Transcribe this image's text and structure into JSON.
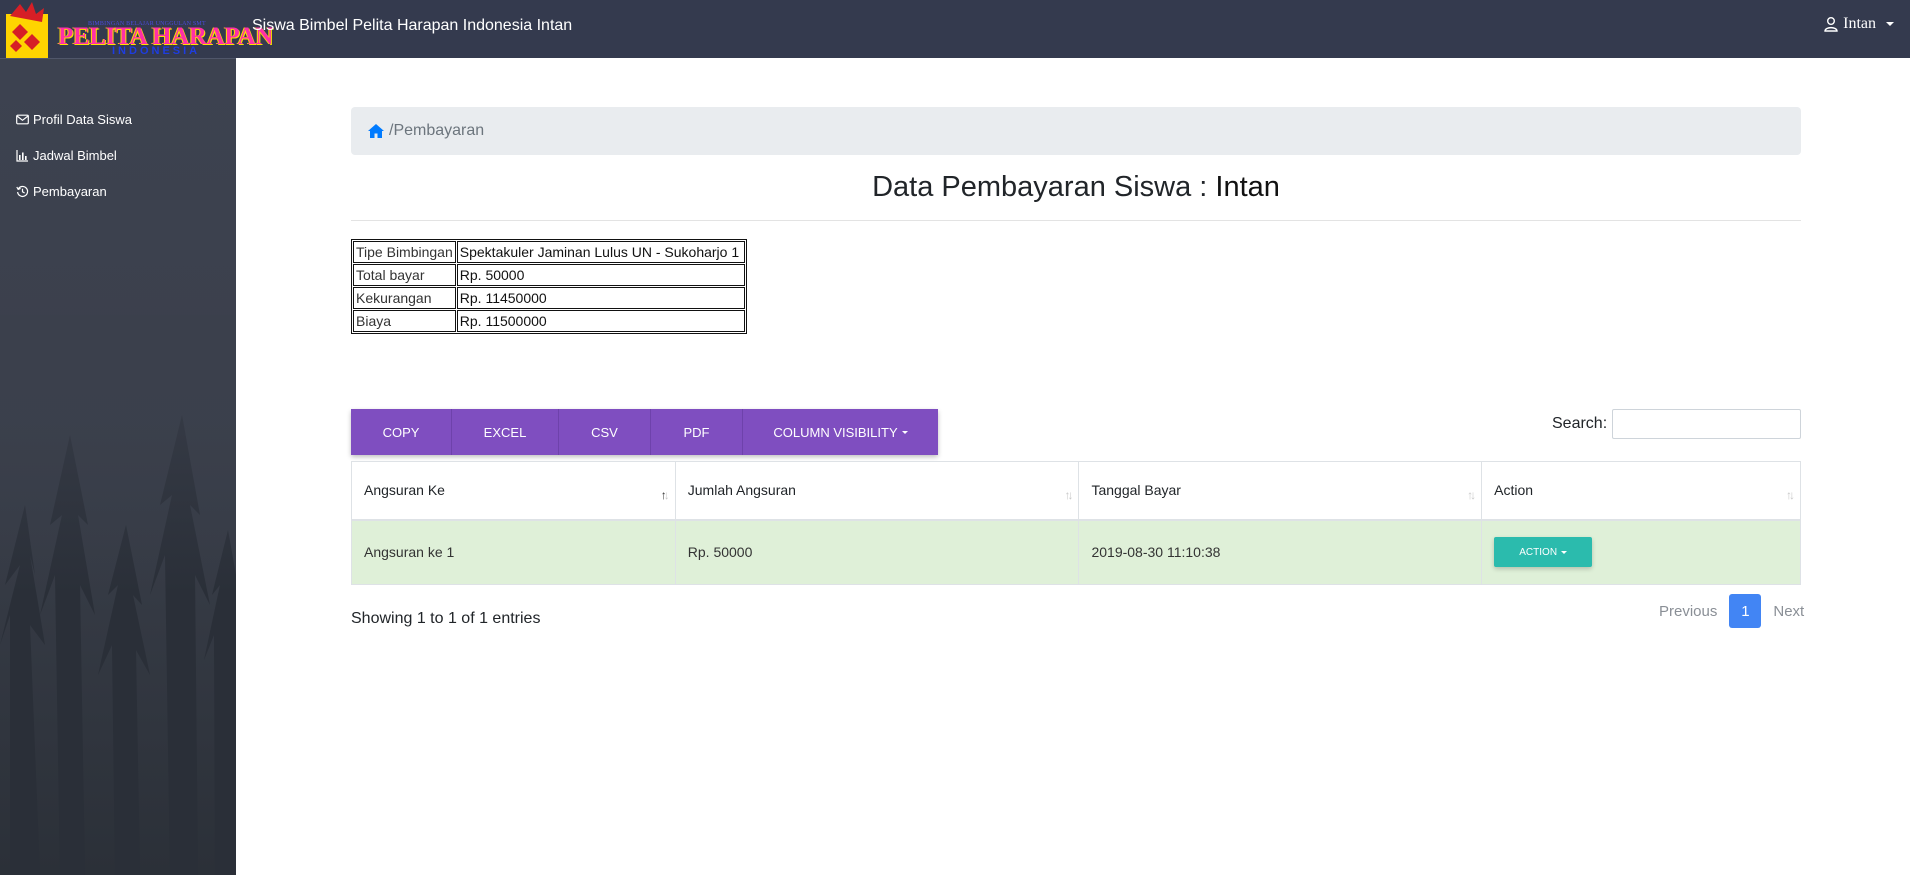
{
  "header": {
    "logo": {
      "small_text": "BIMBINGAN BELAJAR UNGGULAN SMT",
      "main_text": "PELITA HARAPAN",
      "sub_text": "INDONESIA"
    },
    "app_title": "Siswa Bimbel Pelita Harapan Indonesia Intan",
    "user_name": "Intan",
    "user_icon": "user-icon"
  },
  "sidebar": {
    "items": [
      {
        "icon": "envelope-icon",
        "label": "Profil Data Siswa"
      },
      {
        "icon": "bar-chart-icon",
        "label": "Jadwal Bimbel"
      },
      {
        "icon": "history-icon",
        "label": "Pembayaran"
      }
    ]
  },
  "breadcrumb": {
    "icon": "home-icon",
    "separator": "/",
    "current": "Pembayaran"
  },
  "page_title": {
    "prefix": "Data Pembayaran Siswa : ",
    "name": "Intan"
  },
  "info": {
    "rows": [
      {
        "key": "Tipe Bimbingan",
        "value": "Spektakuler Jaminan Lulus UN - Sukoharjo 1"
      },
      {
        "key": "Total bayar",
        "value": "Rp. 50000"
      },
      {
        "key": "Kekurangan",
        "value": "Rp. 11450000"
      },
      {
        "key": "Biaya",
        "value": "Rp. 11500000"
      }
    ]
  },
  "toolbar": {
    "copy": "COPY",
    "excel": "EXCEL",
    "csv": "CSV",
    "pdf": "PDF",
    "column_visibility": "COLUMN VISIBILITY"
  },
  "search": {
    "label": "Search:",
    "value": ""
  },
  "table": {
    "columns": [
      "Angsuran Ke",
      "Jumlah Angsuran",
      "Tanggal Bayar",
      "Action"
    ],
    "sort_column": "Angsuran Ke",
    "sort_direction": "ascending",
    "rows": [
      {
        "angsuran_ke": "Angsuran ke 1",
        "jumlah": "Rp. 50000",
        "tanggal": "2019-08-30 11:10:38",
        "action": "ACTION"
      }
    ]
  },
  "footer": {
    "showing": "Showing 1 to 1 of 1 entries",
    "previous": "Previous",
    "current_page": "1",
    "next": "Next"
  },
  "colors": {
    "navbar": "#343a4e",
    "button_purple": "#7f4ec0",
    "row_highlight": "#dff0d8",
    "action_teal": "#2bbbad",
    "page_active": "#4285f4",
    "home_icon_blue": "#007bff"
  }
}
